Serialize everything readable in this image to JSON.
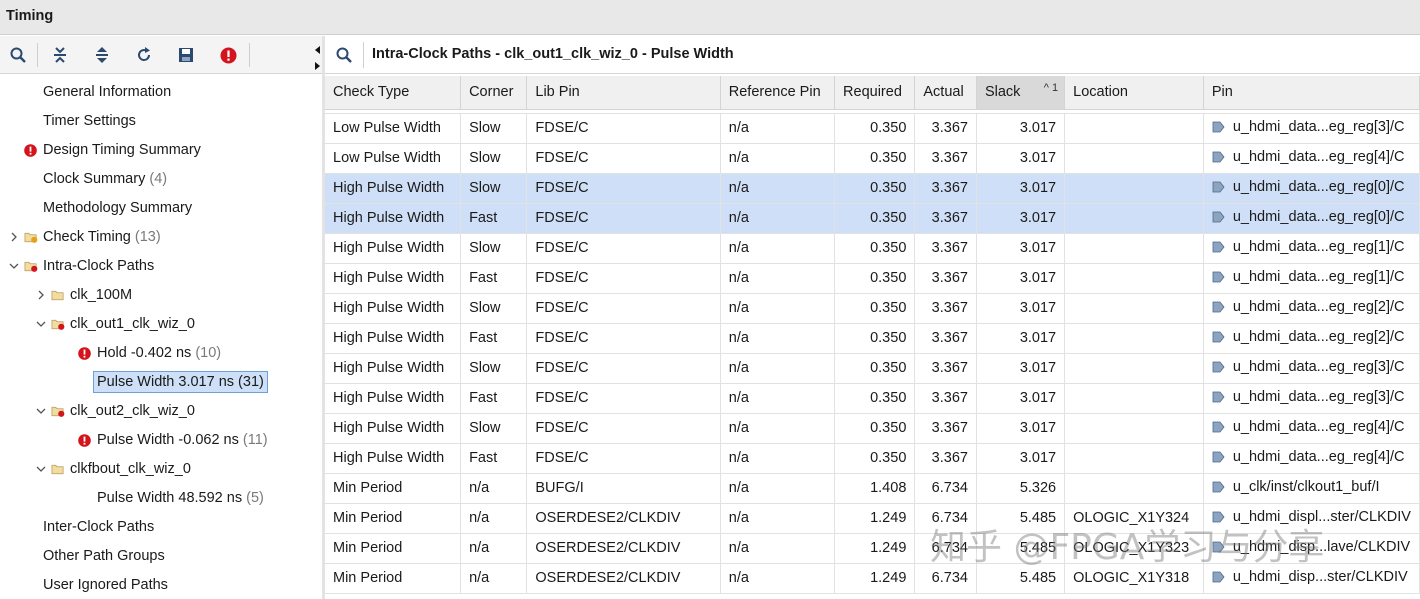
{
  "window": {
    "title": "Timing"
  },
  "tree": {
    "items": [
      {
        "label": "General Information",
        "count": "",
        "level": 0,
        "icon": "none",
        "expander": "none"
      },
      {
        "label": "Timer Settings",
        "count": "",
        "level": 0,
        "icon": "none",
        "expander": "none"
      },
      {
        "label": "Design Timing Summary",
        "count": "",
        "level": 0,
        "icon": "error-icon",
        "expander": "none"
      },
      {
        "label": "Clock Summary",
        "count": "(4)",
        "level": 0,
        "icon": "none",
        "expander": "none"
      },
      {
        "label": "Methodology Summary",
        "count": "",
        "level": 0,
        "icon": "none",
        "expander": "none"
      },
      {
        "label": "Check Timing",
        "count": "(13)",
        "level": 0,
        "icon": "folder-warning-icon",
        "expander": "collapsed"
      },
      {
        "label": "Intra-Clock Paths",
        "count": "",
        "level": 0,
        "icon": "folder-error-icon",
        "expander": "expanded"
      },
      {
        "label": "clk_100M",
        "count": "",
        "level": 1,
        "icon": "folder-icon",
        "expander": "collapsed"
      },
      {
        "label": "clk_out1_clk_wiz_0",
        "count": "",
        "level": 1,
        "icon": "folder-error-icon",
        "expander": "expanded"
      },
      {
        "label": "Hold -0.402 ns",
        "count": "(10)",
        "level": 2,
        "icon": "error-icon",
        "expander": "none"
      },
      {
        "label": "Pulse Width 3.017 ns (31)",
        "count": "",
        "level": 2,
        "icon": "none",
        "expander": "none",
        "selected": true
      },
      {
        "label": "clk_out2_clk_wiz_0",
        "count": "",
        "level": 1,
        "icon": "folder-error-icon",
        "expander": "expanded"
      },
      {
        "label": "Pulse Width -0.062 ns",
        "count": "(11)",
        "level": 2,
        "icon": "error-icon",
        "expander": "none"
      },
      {
        "label": "clkfbout_clk_wiz_0",
        "count": "",
        "level": 1,
        "icon": "folder-icon",
        "expander": "expanded"
      },
      {
        "label": "Pulse Width 48.592 ns",
        "count": "(5)",
        "level": 2,
        "icon": "none",
        "expander": "none"
      },
      {
        "label": "Inter-Clock Paths",
        "count": "",
        "level": 0,
        "icon": "none",
        "expander": "none"
      },
      {
        "label": "Other Path Groups",
        "count": "",
        "level": 0,
        "icon": "none",
        "expander": "none"
      },
      {
        "label": "User Ignored Paths",
        "count": "",
        "level": 0,
        "icon": "none",
        "expander": "none"
      }
    ]
  },
  "toolbar": {
    "buttons": [
      "search-icon",
      "collapse-all-icon",
      "expand-all-icon",
      "refresh-icon",
      "save-icon",
      "error-icon"
    ]
  },
  "panel": {
    "title": "Intra-Clock Paths - clk_out1_clk_wiz_0 - Pulse Width"
  },
  "table": {
    "headers": [
      "Check Type",
      "Corner",
      "Lib Pin",
      "Reference Pin",
      "Required",
      "Actual",
      "Slack",
      "Location",
      "Pin"
    ],
    "sort_indicator": "^ 1",
    "rows": [
      {
        "selected": false,
        "cells": [
          "Low Pulse Width",
          "Slow",
          "FDSE/C",
          "n/a",
          "0.350",
          "3.367",
          "3.017",
          "",
          "u_hdmi_data...eg_reg[3]/C"
        ]
      },
      {
        "selected": false,
        "cells": [
          "Low Pulse Width",
          "Slow",
          "FDSE/C",
          "n/a",
          "0.350",
          "3.367",
          "3.017",
          "",
          "u_hdmi_data...eg_reg[4]/C"
        ]
      },
      {
        "selected": true,
        "cells": [
          "High Pulse Width",
          "Slow",
          "FDSE/C",
          "n/a",
          "0.350",
          "3.367",
          "3.017",
          "",
          "u_hdmi_data...eg_reg[0]/C"
        ]
      },
      {
        "selected": true,
        "cells": [
          "High Pulse Width",
          "Fast",
          "FDSE/C",
          "n/a",
          "0.350",
          "3.367",
          "3.017",
          "",
          "u_hdmi_data...eg_reg[0]/C"
        ]
      },
      {
        "selected": false,
        "cells": [
          "High Pulse Width",
          "Slow",
          "FDSE/C",
          "n/a",
          "0.350",
          "3.367",
          "3.017",
          "",
          "u_hdmi_data...eg_reg[1]/C"
        ]
      },
      {
        "selected": false,
        "cells": [
          "High Pulse Width",
          "Fast",
          "FDSE/C",
          "n/a",
          "0.350",
          "3.367",
          "3.017",
          "",
          "u_hdmi_data...eg_reg[1]/C"
        ]
      },
      {
        "selected": false,
        "cells": [
          "High Pulse Width",
          "Slow",
          "FDSE/C",
          "n/a",
          "0.350",
          "3.367",
          "3.017",
          "",
          "u_hdmi_data...eg_reg[2]/C"
        ]
      },
      {
        "selected": false,
        "cells": [
          "High Pulse Width",
          "Fast",
          "FDSE/C",
          "n/a",
          "0.350",
          "3.367",
          "3.017",
          "",
          "u_hdmi_data...eg_reg[2]/C"
        ]
      },
      {
        "selected": false,
        "cells": [
          "High Pulse Width",
          "Slow",
          "FDSE/C",
          "n/a",
          "0.350",
          "3.367",
          "3.017",
          "",
          "u_hdmi_data...eg_reg[3]/C"
        ]
      },
      {
        "selected": false,
        "cells": [
          "High Pulse Width",
          "Fast",
          "FDSE/C",
          "n/a",
          "0.350",
          "3.367",
          "3.017",
          "",
          "u_hdmi_data...eg_reg[3]/C"
        ]
      },
      {
        "selected": false,
        "cells": [
          "High Pulse Width",
          "Slow",
          "FDSE/C",
          "n/a",
          "0.350",
          "3.367",
          "3.017",
          "",
          "u_hdmi_data...eg_reg[4]/C"
        ]
      },
      {
        "selected": false,
        "cells": [
          "High Pulse Width",
          "Fast",
          "FDSE/C",
          "n/a",
          "0.350",
          "3.367",
          "3.017",
          "",
          "u_hdmi_data...eg_reg[4]/C"
        ]
      },
      {
        "selected": false,
        "cells": [
          "Min Period",
          "n/a",
          "BUFG/I",
          "n/a",
          "1.408",
          "6.734",
          "5.326",
          "",
          "u_clk/inst/clkout1_buf/I"
        ]
      },
      {
        "selected": false,
        "cells": [
          "Min Period",
          "n/a",
          "OSERDESE2/CLKDIV",
          "n/a",
          "1.249",
          "6.734",
          "5.485",
          "OLOGIC_X1Y324",
          "u_hdmi_displ...ster/CLKDIV"
        ]
      },
      {
        "selected": false,
        "cells": [
          "Min Period",
          "n/a",
          "OSERDESE2/CLKDIV",
          "n/a",
          "1.249",
          "6.734",
          "5.485",
          "OLOGIC_X1Y323",
          "u_hdmi_disp...lave/CLKDIV"
        ]
      },
      {
        "selected": false,
        "cells": [
          "Min Period",
          "n/a",
          "OSERDESE2/CLKDIV",
          "n/a",
          "1.249",
          "6.734",
          "5.485",
          "OLOGIC_X1Y318",
          "u_hdmi_disp...ster/CLKDIV"
        ]
      }
    ]
  },
  "watermark": "知乎 @FPGA学习与分享",
  "colors": {
    "selection": "#cfdff7",
    "error": "#d3141c",
    "header_bg": "#f0f0f0"
  }
}
